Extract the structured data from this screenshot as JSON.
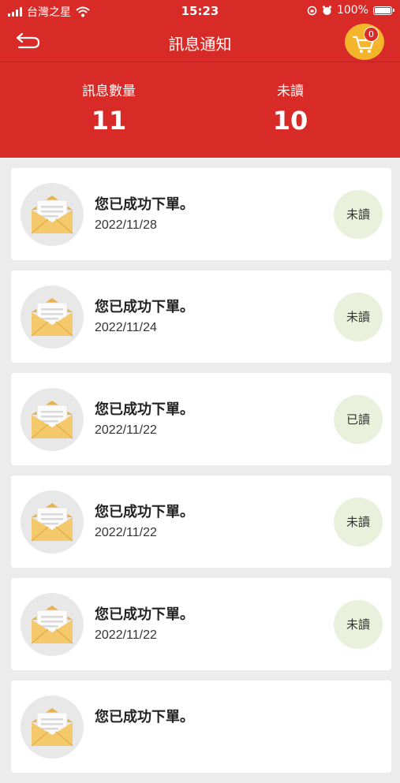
{
  "status_bar": {
    "carrier": "台灣之星",
    "time": "15:23",
    "battery": "100%"
  },
  "nav": {
    "title": "訊息通知",
    "cart_count": "0"
  },
  "summary": {
    "total_label": "訊息數量",
    "total_value": "11",
    "unread_label": "未讀",
    "unread_value": "10"
  },
  "messages": [
    {
      "title": "您已成功下單。",
      "date": "2022/11/28",
      "status": "未讀"
    },
    {
      "title": "您已成功下單。",
      "date": "2022/11/24",
      "status": "未讀"
    },
    {
      "title": "您已成功下單。",
      "date": "2022/11/22",
      "status": "已讀"
    },
    {
      "title": "您已成功下單。",
      "date": "2022/11/22",
      "status": "未讀"
    },
    {
      "title": "您已成功下單。",
      "date": "2022/11/22",
      "status": "未讀"
    },
    {
      "title": "您已成功下單。",
      "date": "",
      "status": ""
    }
  ],
  "colors": {
    "primary": "#d82a27",
    "cart": "#f5b52a",
    "badge_bg": "#e9f0dc",
    "envelope": "#f3c96c"
  }
}
